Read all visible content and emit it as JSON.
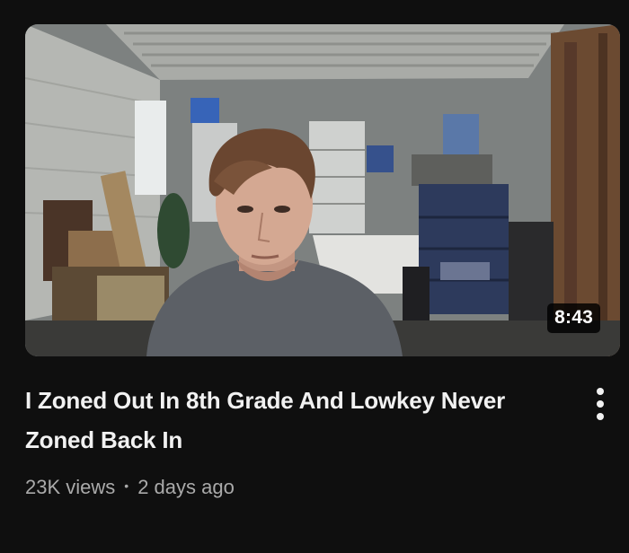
{
  "video": {
    "title": "I Zoned Out In 8th Grade And Lowkey Never Zoned Back In",
    "duration": "8:43",
    "views": "23K views",
    "separator": "•",
    "age": "2 days ago"
  },
  "icons": {
    "menu": "more-vert-icon"
  },
  "colors": {
    "background": "#0f0f0f",
    "title": "#f1f1f1",
    "secondary_text": "#aaaaaa",
    "duration_badge": "#000000"
  }
}
